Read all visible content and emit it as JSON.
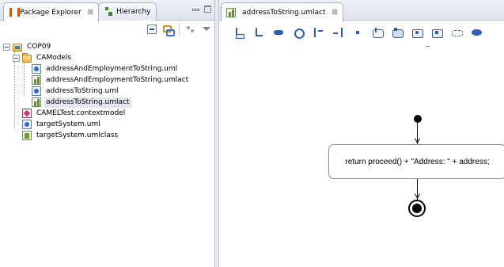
{
  "left_panel": {
    "tabs": [
      {
        "label": "Package Explorer",
        "active": true,
        "close": "⊠"
      },
      {
        "label": "Hierarchy",
        "active": false
      }
    ],
    "tree": [
      {
        "label": "COP09",
        "level": 0,
        "kind": "project",
        "expanded": true
      },
      {
        "label": "CAModels",
        "level": 1,
        "kind": "folder",
        "expanded": true
      },
      {
        "label": "addressAndEmploymentToString.uml",
        "level": 2,
        "kind": "uml"
      },
      {
        "label": "addressAndEmploymentToString.umlact",
        "level": 2,
        "kind": "umlact"
      },
      {
        "label": "addressToString.uml",
        "level": 2,
        "kind": "uml"
      },
      {
        "label": "addressToString.umlact",
        "level": 2,
        "kind": "umlact",
        "selected": true
      },
      {
        "label": "CAMELTest.contextmodel",
        "level": 1,
        "kind": "contextmodel"
      },
      {
        "label": "targetSystem.uml",
        "level": 1,
        "kind": "uml"
      },
      {
        "label": "targetSystem.umlclass",
        "level": 1,
        "kind": "umlclass"
      }
    ]
  },
  "editor": {
    "tab": {
      "label": "addressToString.umlact",
      "close": "⊠"
    },
    "diagram": {
      "action_text": "return proceed() + \"Address: \" + address;"
    }
  }
}
